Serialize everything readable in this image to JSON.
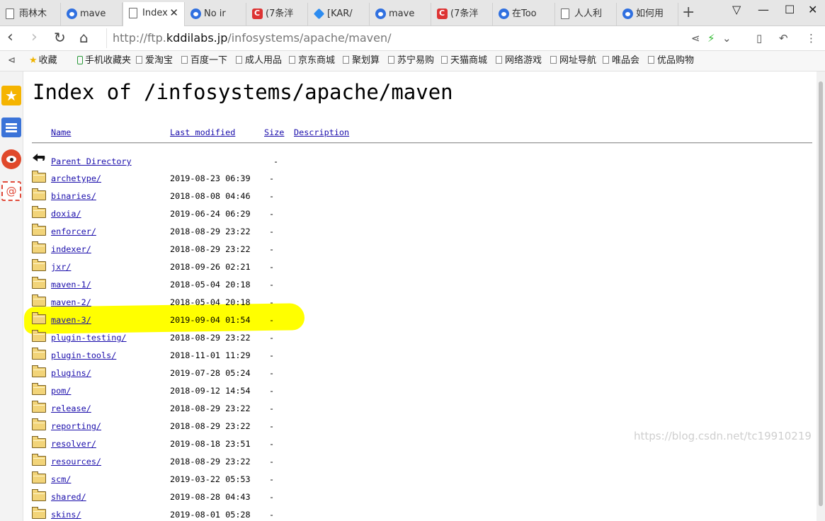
{
  "tabs": [
    {
      "label": "雨林木",
      "icon": "document-icon"
    },
    {
      "label": "mave",
      "icon": "baidu-paw-icon"
    },
    {
      "label": "Index",
      "icon": "document-icon",
      "active": true
    },
    {
      "label": "No ir",
      "icon": "baidu-paw-icon"
    },
    {
      "label": "(7条泮",
      "icon": "csdn-icon"
    },
    {
      "label": "[KAR/",
      "icon": "diamond-icon"
    },
    {
      "label": "mave",
      "icon": "baidu-paw-icon"
    },
    {
      "label": "(7条泮",
      "icon": "csdn-icon"
    },
    {
      "label": "在Too",
      "icon": "baidu-paw-icon"
    },
    {
      "label": "人人利",
      "icon": "document-icon"
    },
    {
      "label": "如何用",
      "icon": "baidu-paw-icon"
    }
  ],
  "address": {
    "prefix": "http://ftp.",
    "host": "kddilabs.jp",
    "path": "/infosystems/apache/maven/"
  },
  "bookmarks": [
    "收藏",
    "手机收藏夹",
    "爱淘宝",
    "百度一下",
    "成人用品",
    "京东商城",
    "聚划算",
    "苏宁易购",
    "天猫商城",
    "网络游戏",
    "网址导航",
    "唯品会",
    "优品购物"
  ],
  "page": {
    "title": "Index of /infosystems/apache/maven",
    "columns": {
      "name": "Name",
      "modified": "Last modified",
      "size": "Size",
      "description": "Description"
    },
    "parent": {
      "name": "Parent Directory",
      "size": "-"
    },
    "entries": [
      {
        "name": "archetype/",
        "date": "2019-08-23 06:39",
        "size": "-"
      },
      {
        "name": "binaries/",
        "date": "2018-08-08 04:46",
        "size": "-"
      },
      {
        "name": "doxia/",
        "date": "2019-06-24 06:29",
        "size": "-"
      },
      {
        "name": "enforcer/",
        "date": "2018-08-29 23:22",
        "size": "-"
      },
      {
        "name": "indexer/",
        "date": "2018-08-29 23:22",
        "size": "-"
      },
      {
        "name": "jxr/",
        "date": "2018-09-26 02:21",
        "size": "-"
      },
      {
        "name": "maven-1/",
        "date": "2018-05-04 20:18",
        "size": "-"
      },
      {
        "name": "maven-2/",
        "date": "2018-05-04 20:18",
        "size": "-"
      },
      {
        "name": "maven-3/",
        "date": "2019-09-04 01:54",
        "size": "-",
        "highlighted": true
      },
      {
        "name": "plugin-testing/",
        "date": "2018-08-29 23:22",
        "size": "-"
      },
      {
        "name": "plugin-tools/",
        "date": "2018-11-01 11:29",
        "size": "-"
      },
      {
        "name": "plugins/",
        "date": "2019-07-28 05:24",
        "size": "-"
      },
      {
        "name": "pom/",
        "date": "2018-09-12 14:54",
        "size": "-"
      },
      {
        "name": "release/",
        "date": "2018-08-29 23:22",
        "size": "-"
      },
      {
        "name": "reporting/",
        "date": "2018-08-29 23:22",
        "size": "-"
      },
      {
        "name": "resolver/",
        "date": "2019-08-18 23:51",
        "size": "-"
      },
      {
        "name": "resources/",
        "date": "2018-08-29 23:22",
        "size": "-"
      },
      {
        "name": "scm/",
        "date": "2019-03-22 05:53",
        "size": "-"
      },
      {
        "name": "shared/",
        "date": "2019-08-28 04:43",
        "size": "-"
      },
      {
        "name": "skins/",
        "date": "2019-08-01 05:28",
        "size": "-"
      }
    ],
    "highlight_color": "#ffff00"
  },
  "watermark": "https://blog.csdn.net/tc19910219"
}
